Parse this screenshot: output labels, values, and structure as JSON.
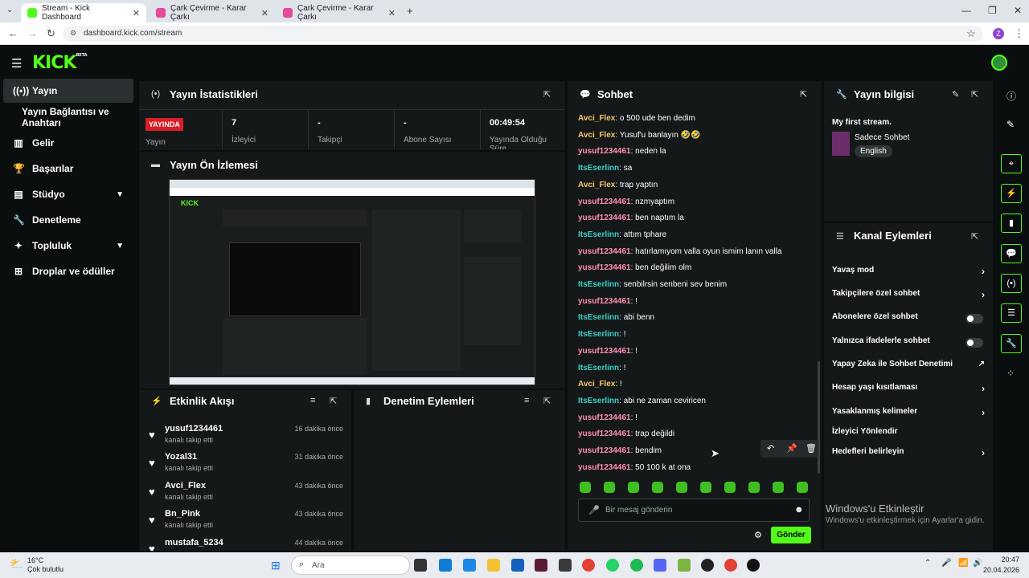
{
  "browser": {
    "tabs": [
      {
        "label": "Stream - Kick Dashboard",
        "active": true
      },
      {
        "label": "Çark Çevirme - Karar Çarkı",
        "active": false
      },
      {
        "label": "Çark Çevirme - Karar Çarkı",
        "active": false
      }
    ],
    "url": "dashboard.kick.com/stream",
    "profile_initial": "Z"
  },
  "brand": {
    "logo": "KICK",
    "beta": "BETA"
  },
  "sidebar": {
    "items": [
      {
        "label": "Yayın",
        "icon": "broadcast-icon",
        "active": true
      },
      {
        "label": "Yayın Bağlantısı ve Anahtarı",
        "icon": "",
        "active": false
      },
      {
        "label": "Gelir",
        "icon": "chart-icon",
        "active": false
      },
      {
        "label": "Başarılar",
        "icon": "trophy-icon",
        "active": false
      },
      {
        "label": "Stüdyo",
        "icon": "studio-icon",
        "active": false,
        "expandable": true
      },
      {
        "label": "Denetleme",
        "icon": "wrench-icon",
        "active": false
      },
      {
        "label": "Topluluk",
        "icon": "community-icon",
        "active": false,
        "expandable": true
      },
      {
        "label": "Droplar ve ödüller",
        "icon": "gift-icon",
        "active": false
      }
    ]
  },
  "stats": {
    "title": "Yayın İstatistikleri",
    "live_badge": "YAYINDA",
    "live_label": "Yayın",
    "items": [
      {
        "value": "7",
        "label": "İzleyici"
      },
      {
        "value": "-",
        "label": "Takipçi"
      },
      {
        "value": "-",
        "label": "Abone Sayısı"
      },
      {
        "value": "00:49:54",
        "label": "Yayında Olduğu Süre"
      }
    ]
  },
  "preview": {
    "title": "Yayın Ön İzlemesi"
  },
  "activity": {
    "title": "Etkinlik Akışı",
    "items": [
      {
        "name": "yusuf1234461",
        "sub": "kanalı takip etti",
        "time": "16 dakika önce"
      },
      {
        "name": "Yozal31",
        "sub": "kanalı takip etti",
        "time": "31 dakika önce"
      },
      {
        "name": "Avci_Flex",
        "sub": "kanalı takip etti",
        "time": "43 dakika önce"
      },
      {
        "name": "Bn_Pink",
        "sub": "kanalı takip etti",
        "time": "43 dakika önce"
      },
      {
        "name": "mustafa_5234",
        "sub": "",
        "time": "44 dakika önce"
      }
    ]
  },
  "moderation": {
    "title": "Denetim Eylemleri"
  },
  "chat": {
    "title": "Sohbet",
    "messages": [
      {
        "user": "Avci_Flex",
        "color": "#f2c86b",
        "text": "o 500 ude ben dedim"
      },
      {
        "user": "Avci_Flex",
        "color": "#f2c86b",
        "text": "Yusuf'u banlayın 🤣🤣"
      },
      {
        "user": "yusuf1234461",
        "color": "#ff8fb3",
        "text": "neden la"
      },
      {
        "user": "ItsEserlinn",
        "color": "#3ad1c9",
        "text": "sa"
      },
      {
        "user": "Avci_Flex",
        "color": "#f2c86b",
        "text": "trap yaptın"
      },
      {
        "user": "yusuf1234461",
        "color": "#ff8fb3",
        "text": "nzmyaptım"
      },
      {
        "user": "yusuf1234461",
        "color": "#ff8fb3",
        "text": "ben naptım la"
      },
      {
        "user": "ItsEserlinn",
        "color": "#3ad1c9",
        "text": "attım tphare"
      },
      {
        "user": "yusuf1234461",
        "color": "#ff8fb3",
        "text": "hatırlamıyom valla oyun ismim lanın valla"
      },
      {
        "user": "yusuf1234461",
        "color": "#ff8fb3",
        "text": "ben değilim olm"
      },
      {
        "user": "ItsEserlinn",
        "color": "#3ad1c9",
        "text": "senbilrsin senbeni sev benim"
      },
      {
        "user": "yusuf1234461",
        "color": "#ff8fb3",
        "text": "!"
      },
      {
        "user": "ItsEserlinn",
        "color": "#3ad1c9",
        "text": "abi benn"
      },
      {
        "user": "ItsEserlinn",
        "color": "#3ad1c9",
        "text": "!"
      },
      {
        "user": "yusuf1234461",
        "color": "#ff8fb3",
        "text": "!"
      },
      {
        "user": "ItsEserlinn",
        "color": "#3ad1c9",
        "text": "!"
      },
      {
        "user": "Avci_Flex",
        "color": "#f2c86b",
        "text": "!"
      },
      {
        "user": "ItsEserlinn",
        "color": "#3ad1c9",
        "text": "abi ne zaman ceviricen"
      },
      {
        "user": "yusuf1234461",
        "color": "#ff8fb3",
        "text": "!"
      },
      {
        "user": "yusuf1234461",
        "color": "#ff8fb3",
        "text": "trap değildi"
      },
      {
        "user": "yusuf1234461",
        "color": "#ff8fb3",
        "text": "bendim"
      },
      {
        "user": "yusuf1234461",
        "color": "#ff8fb3",
        "text": "50 100 k at ona"
      }
    ],
    "input_placeholder": "Bir mesaj gönderin",
    "send_label": "Gönder"
  },
  "stream_info": {
    "title": "Yayın bilgisi",
    "stream_title": "My first stream.",
    "category": "Sadece Sohbet",
    "language": "English"
  },
  "channel_actions": {
    "title": "Kanal Eylemleri",
    "items": [
      {
        "label": "Yavaş mod",
        "control": "arrow"
      },
      {
        "label": "Takipçilere özel sohbet",
        "control": "arrow"
      },
      {
        "label": "Abonelere özel sohbet",
        "control": "toggle"
      },
      {
        "label": "Yalnızca ifadelerle sohbet",
        "control": "toggle"
      },
      {
        "label": "Yapay Zeka ile Sohbet Denetimi",
        "control": "external"
      },
      {
        "label": "Hesap yaşı kısıtlaması",
        "control": "arrow"
      },
      {
        "label": "Yasaklanmış kelimeler",
        "control": "arrow"
      },
      {
        "label": "İzleyici Yönlendir",
        "control": "none"
      },
      {
        "label": "Hedefleri belirleyin",
        "control": "arrow"
      }
    ]
  },
  "watermark": {
    "title": "Windows'u Etkinleştir",
    "sub": "Windows'u etkinleştirmek için Ayarlar'a gidin."
  },
  "taskbar": {
    "weather_temp": "16°C",
    "weather_desc": "Çok bulutlu",
    "search_placeholder": "Ara",
    "time": "20:47",
    "date": "20.04.2026"
  }
}
